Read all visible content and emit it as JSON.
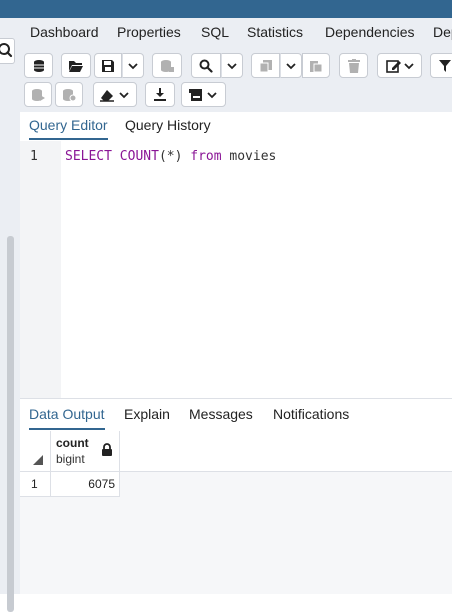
{
  "main_tabs": [
    "Dashboard",
    "Properties",
    "SQL",
    "Statistics",
    "Dependencies",
    "Dep"
  ],
  "editor_tabs": {
    "query_editor": "Query Editor",
    "query_history": "Query History"
  },
  "editor": {
    "line_number": "1",
    "code": {
      "select": "SELECT",
      "count": "COUNT",
      "args": "(*)",
      "from": "from",
      "table": "movies"
    }
  },
  "output_tabs": [
    "Data Output",
    "Explain",
    "Messages",
    "Notifications"
  ],
  "result": {
    "column": {
      "name": "count",
      "type": "bigint"
    },
    "rows": [
      {
        "row_number": "1",
        "value": "6075"
      }
    ]
  },
  "colors": {
    "accent": "#326690",
    "keyword": "#8a1596",
    "toolbar_bg": "#ebeef3"
  }
}
